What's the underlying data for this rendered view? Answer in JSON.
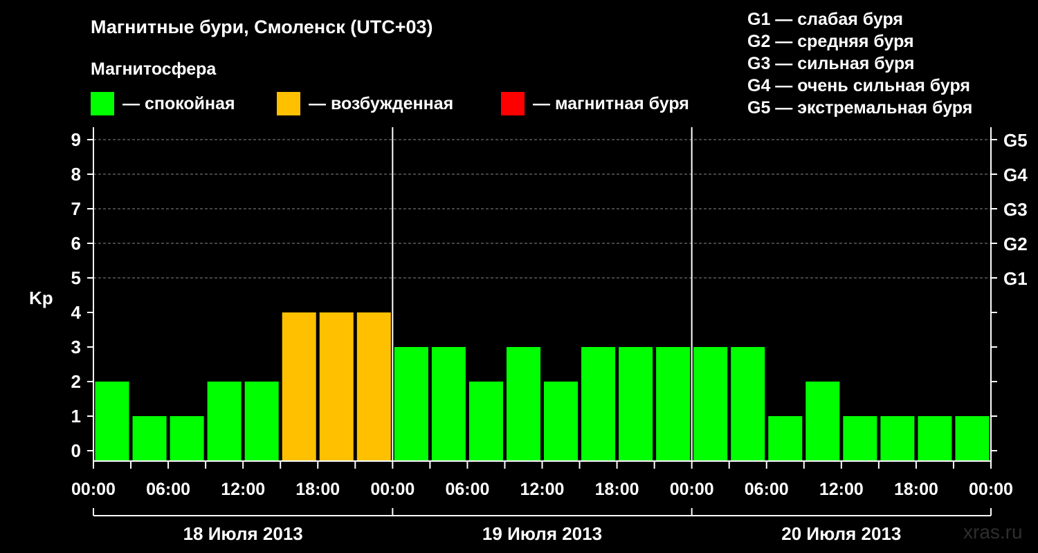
{
  "title": "Магнитные бури, Смоленск (UTC+03)",
  "subtitle": "Магнитосфера",
  "legend": [
    {
      "label": "— спокойная",
      "color": "#00ff00"
    },
    {
      "label": "— возбужденная",
      "color": "#ffc000"
    },
    {
      "label": "— магнитная буря",
      "color": "#ff0000"
    }
  ],
  "g_legend": [
    "G1 — слабая буря",
    "G2 — средняя буря",
    "G3 — сильная буря",
    "G4 — очень сильная буря",
    "G5 — экстремальная буря"
  ],
  "watermark": "xras.ru",
  "chart_data": {
    "type": "bar",
    "ylabel": "Kp",
    "ylim": [
      0,
      9
    ],
    "yticks": [
      "0",
      "1",
      "2",
      "3",
      "4",
      "5",
      "6",
      "7",
      "8",
      "9"
    ],
    "right_ticks": [
      {
        "value": 5,
        "label": "G1"
      },
      {
        "value": 6,
        "label": "G2"
      },
      {
        "value": 7,
        "label": "G3"
      },
      {
        "value": 8,
        "label": "G4"
      },
      {
        "value": 9,
        "label": "G5"
      }
    ],
    "grid": "dashed horizontal lines at Kp 5–9",
    "xticks": [
      "00:00",
      "06:00",
      "12:00",
      "18:00",
      "00:00",
      "06:00",
      "12:00",
      "18:00",
      "00:00",
      "06:00",
      "12:00",
      "18:00",
      "00:00"
    ],
    "days": [
      "18 Июля 2013",
      "19 Июля 2013",
      "20 Июля 2013"
    ],
    "interval_hours": 3,
    "values": [
      2,
      1,
      1,
      2,
      2,
      4,
      4,
      4,
      3,
      3,
      2,
      3,
      2,
      3,
      3,
      3,
      3,
      3,
      1,
      2,
      1,
      1,
      1,
      1
    ],
    "colors": {
      "quiet": "#00ff00",
      "active": "#ffc000",
      "storm": "#ff0000"
    },
    "thresholds": {
      "active_min": 4,
      "storm_min": 5
    }
  }
}
